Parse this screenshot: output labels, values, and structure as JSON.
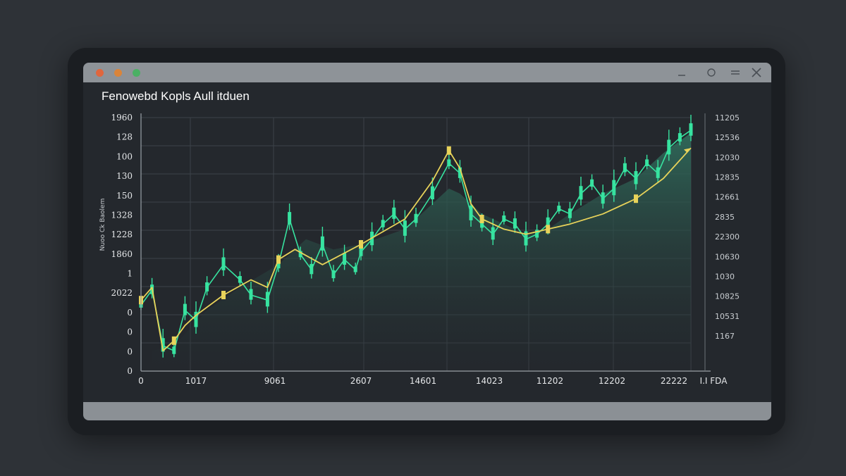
{
  "window": {
    "title": "Fenowebd Kopls Aull itduen",
    "controls": [
      "minimize-icon",
      "maximize-icon",
      "menu-icon",
      "close-icon"
    ]
  },
  "colors": {
    "candle": "#37e3a0",
    "trend": "#e8d35a",
    "area": "#2a5a4d",
    "grid": "#3c4249"
  },
  "chart_data": {
    "type": "line",
    "title": "Fenowebd Kopls Aull itduen",
    "xlabel": "",
    "ylabel": "Nuoo Ck Baolem",
    "left_ticks": [
      "1960",
      "128",
      "100",
      "130",
      "150",
      "1328",
      "1228",
      "1860",
      "1",
      "2022",
      "0",
      "0",
      "0",
      "0"
    ],
    "right_ticks": [
      "11205",
      "12536",
      "12030",
      "12835",
      "12661",
      "2835",
      "22300",
      "10630",
      "1030",
      "10825",
      "10531",
      "1167"
    ],
    "x_ticks": [
      "0",
      "1017",
      "9061",
      "2607",
      "14601",
      "14023",
      "11202",
      "12202",
      "22222",
      "I.I FDA"
    ],
    "xlim": [
      0,
      100
    ],
    "ylim": [
      0,
      100
    ],
    "grid": true,
    "series": [
      {
        "kind": "price",
        "x": [
          0,
          2,
          4,
          6,
          8,
          10,
          12,
          15,
          18,
          20,
          23,
          25,
          27,
          29,
          31,
          33,
          35,
          37,
          39,
          40,
          42,
          44,
          46,
          48,
          50,
          53,
          56,
          58,
          60,
          62,
          64,
          66,
          68,
          70,
          72,
          74,
          76,
          78,
          80,
          82,
          84,
          86,
          88,
          90,
          92,
          94,
          96,
          98,
          100
        ],
        "y": [
          26,
          32,
          10,
          8,
          24,
          20,
          33,
          42,
          36,
          30,
          28,
          42,
          60,
          46,
          40,
          50,
          38,
          44,
          40,
          47,
          52,
          58,
          62,
          56,
          60,
          70,
          82,
          78,
          62,
          58,
          54,
          60,
          58,
          52,
          54,
          58,
          64,
          62,
          70,
          74,
          68,
          72,
          80,
          76,
          82,
          78,
          88,
          92,
          95
        ]
      },
      {
        "kind": "trend",
        "x": [
          0,
          2,
          4,
          6,
          8,
          10,
          15,
          20,
          23,
          25,
          28,
          33,
          40,
          48,
          53,
          56,
          58,
          60,
          62,
          66,
          70,
          74,
          78,
          84,
          90,
          95,
          100
        ],
        "y": [
          28,
          33,
          8,
          12,
          18,
          22,
          30,
          36,
          33,
          44,
          48,
          42,
          50,
          60,
          75,
          87,
          80,
          66,
          60,
          56,
          54,
          56,
          58,
          62,
          68,
          76,
          88
        ]
      },
      {
        "kind": "area",
        "x": [
          2,
          6,
          12,
          18,
          25,
          30,
          35,
          40,
          48,
          53,
          56,
          58,
          62,
          66,
          70,
          74,
          78,
          84,
          90,
          95,
          100
        ],
        "y": [
          8,
          10,
          24,
          33,
          42,
          52,
          48,
          50,
          56,
          66,
          72,
          70,
          62,
          58,
          54,
          56,
          62,
          70,
          76,
          86,
          94
        ]
      }
    ]
  }
}
